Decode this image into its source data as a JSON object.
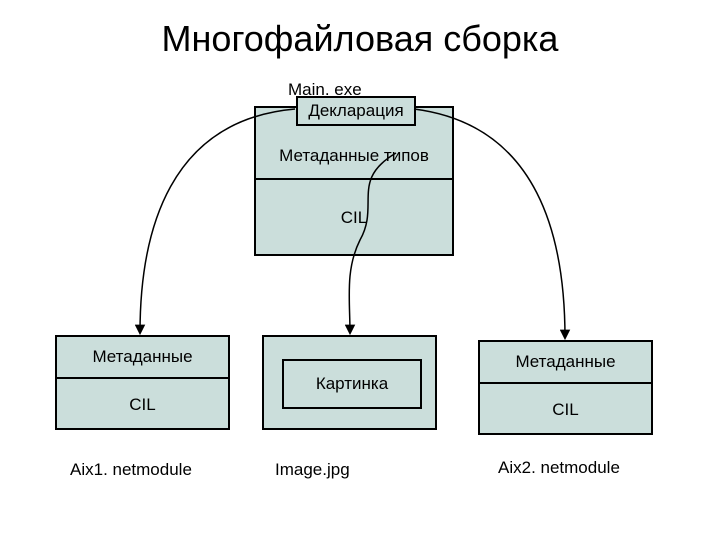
{
  "title": "Многофайловая сборка",
  "main": {
    "caption": "Main. exe",
    "declaration": "Декларация",
    "metadata": "Метаданные типов",
    "cil": "CIL"
  },
  "left": {
    "metadata": "Метаданные",
    "cil": "CIL",
    "caption": "Aix1. netmodule"
  },
  "middle": {
    "picture": "Картинка",
    "caption": "Image.jpg"
  },
  "right": {
    "metadata": "Метаданные",
    "cil": "CIL",
    "caption": "Aix2. netmodule"
  },
  "colors": {
    "fill": "#cbdedb",
    "stroke": "#000000"
  }
}
